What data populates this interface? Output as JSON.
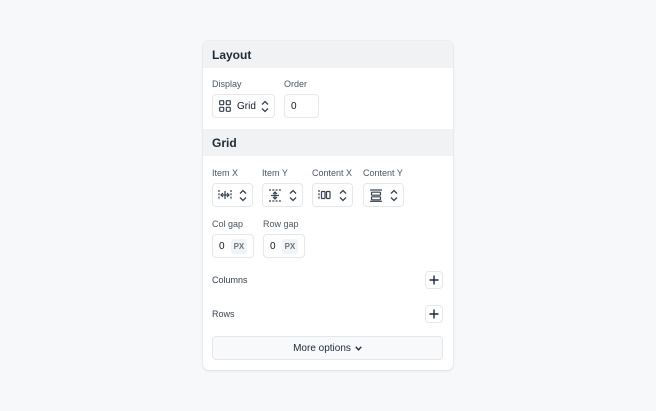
{
  "layout": {
    "title": "Layout",
    "display_label": "Display",
    "display_value": "Grid",
    "order_label": "Order",
    "order_value": "0"
  },
  "grid": {
    "title": "Grid",
    "item_x_label": "Item X",
    "item_y_label": "Item Y",
    "content_x_label": "Content X",
    "content_y_label": "Content Y",
    "col_gap_label": "Col gap",
    "col_gap_value": "0",
    "col_gap_unit": "PX",
    "row_gap_label": "Row gap",
    "row_gap_value": "0",
    "row_gap_unit": "PX",
    "columns_label": "Columns",
    "rows_label": "Rows"
  },
  "more_options_label": "More options"
}
